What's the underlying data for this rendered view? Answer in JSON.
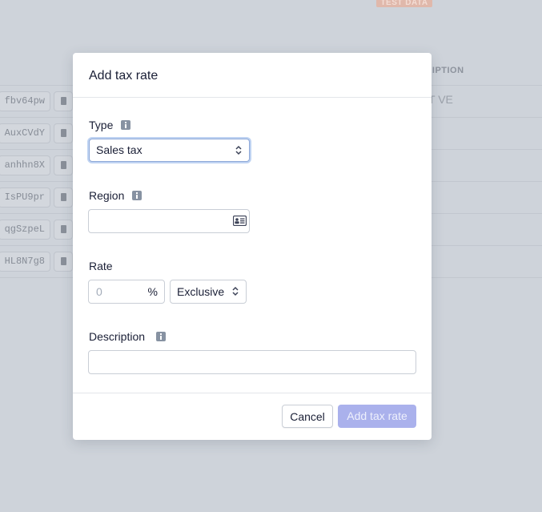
{
  "background": {
    "badge": "TEST DATA",
    "column_header": "CRIPTION",
    "rows": [
      {
        "id": "fbv64pw",
        "desc": "T VE"
      },
      {
        "id": "AuxCVdY",
        "desc": ""
      },
      {
        "id": "anhhn8X",
        "desc": ""
      },
      {
        "id": "IsPU9pr",
        "desc": ""
      },
      {
        "id": "qgSzpeL",
        "desc": ""
      },
      {
        "id": "HL8N7g8",
        "desc": ""
      }
    ]
  },
  "modal": {
    "title": "Add tax rate",
    "type": {
      "label": "Type",
      "value": "Sales tax"
    },
    "region": {
      "label": "Region",
      "value": ""
    },
    "rate": {
      "label": "Rate",
      "placeholder": "0",
      "unit": "%",
      "inclusive_value": "Exclusive"
    },
    "description": {
      "label": "Description",
      "value": ""
    },
    "cancel_label": "Cancel",
    "submit_label": "Add tax rate"
  },
  "colors": {
    "primary_disabled": "#aab1ec",
    "focus_ring": "#bfd3f2",
    "overlay": "#ced3da"
  },
  "icons": [
    "info-icon",
    "chevron-updown-icon",
    "contact-card-icon",
    "clipboard-icon"
  ]
}
